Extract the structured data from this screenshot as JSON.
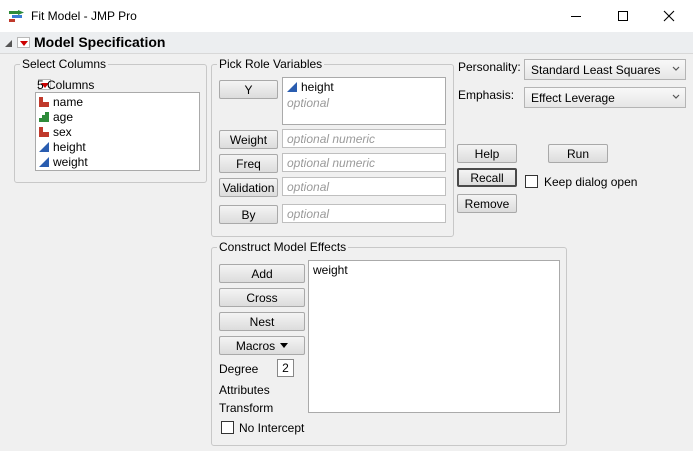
{
  "window": {
    "title": "Fit Model - JMP Pro",
    "icons": [
      "app-icon",
      "minimize-icon",
      "maximize-icon",
      "close-icon"
    ]
  },
  "header": {
    "title": "Model Specification"
  },
  "select_columns": {
    "legend": "Select Columns",
    "count_label": "5 Columns",
    "columns": [
      {
        "name": "name",
        "icon": "nominal-icon",
        "color": "#c0392b"
      },
      {
        "name": "age",
        "icon": "ordinal-icon",
        "color": "#2e8b3a"
      },
      {
        "name": "sex",
        "icon": "nominal-icon",
        "color": "#c0392b"
      },
      {
        "name": "height",
        "icon": "continuous-icon",
        "color": "#2a5db0"
      },
      {
        "name": "weight",
        "icon": "continuous-icon",
        "color": "#2a5db0"
      }
    ]
  },
  "roles": {
    "legend": "Pick Role Variables",
    "y": {
      "button": "Y",
      "value": "height",
      "placeholder": "optional"
    },
    "weight": {
      "button": "Weight",
      "placeholder": "optional numeric"
    },
    "freq": {
      "button": "Freq",
      "placeholder": "optional numeric"
    },
    "validation": {
      "button": "Validation",
      "placeholder": "optional"
    },
    "by": {
      "button": "By",
      "placeholder": "optional"
    }
  },
  "settings": {
    "personality_label": "Personality:",
    "personality_value": "Standard Least Squares",
    "emphasis_label": "Emphasis:",
    "emphasis_value": "Effect Leverage"
  },
  "actions": {
    "help": "Help",
    "run": "Run",
    "recall": "Recall",
    "remove": "Remove",
    "keep_open": "Keep dialog open"
  },
  "effects": {
    "legend": "Construct Model Effects",
    "add": "Add",
    "cross": "Cross",
    "nest": "Nest",
    "macros": "Macros",
    "degree_label": "Degree",
    "degree_value": "2",
    "attributes_label": "Attributes",
    "transform_label": "Transform",
    "no_intercept": "No Intercept",
    "items": [
      "weight"
    ]
  }
}
